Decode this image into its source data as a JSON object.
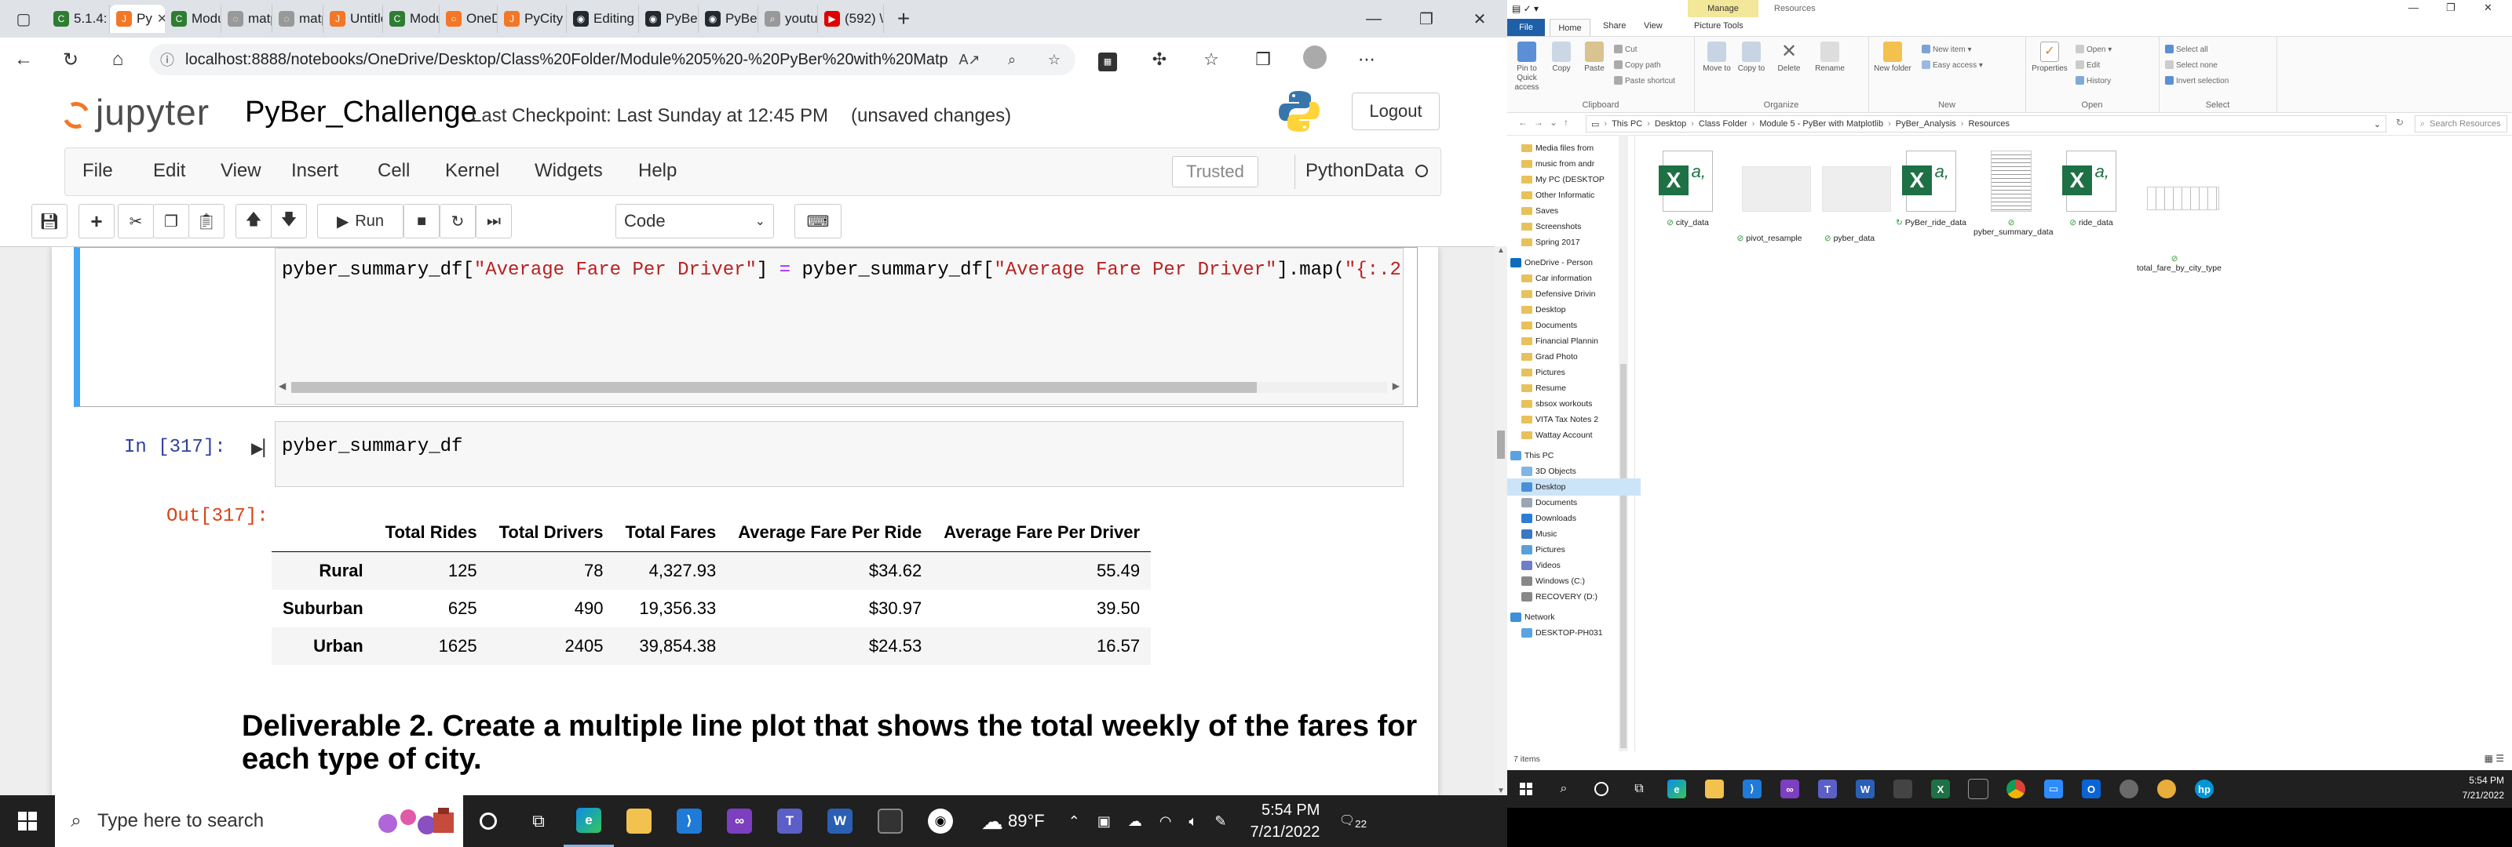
{
  "browser": {
    "tabs": [
      {
        "label": "5.1.4: A",
        "fav_color": "#2e7d32",
        "fav_glyph": "C"
      },
      {
        "label": "Py",
        "fav_color": "#f37726",
        "fav_glyph": "J",
        "active": true
      },
      {
        "label": "Modul",
        "fav_color": "#2e7d32",
        "fav_glyph": "C"
      },
      {
        "label": "matpl",
        "fav_color": "#999999",
        "fav_glyph": "◌"
      },
      {
        "label": "matpl",
        "fav_color": "#999999",
        "fav_glyph": "◌"
      },
      {
        "label": "Untitle",
        "fav_color": "#f37726",
        "fav_glyph": "J"
      },
      {
        "label": "Modul",
        "fav_color": "#2e7d32",
        "fav_glyph": "C"
      },
      {
        "label": "OneDr",
        "fav_color": "#f37726",
        "fav_glyph": "○"
      },
      {
        "label": "PyCity",
        "fav_color": "#f37726",
        "fav_glyph": "J"
      },
      {
        "label": "Editing",
        "fav_color": "#24292f",
        "fav_glyph": "◉"
      },
      {
        "label": "PyBer_",
        "fav_color": "#24292f",
        "fav_glyph": "◉"
      },
      {
        "label": "PyBer_",
        "fav_color": "#24292f",
        "fav_glyph": "◉"
      },
      {
        "label": "youtul",
        "fav_color": "#999999",
        "fav_glyph": "⌕"
      },
      {
        "label": "(592) \\",
        "fav_color": "#e00000",
        "fav_glyph": "▶"
      }
    ],
    "url": "localhost:8888/notebooks/OneDrive/Desktop/Class%20Folder/Module%205%20-%20PyBer%20with%20Matpl..."
  },
  "jupyter": {
    "logo_text": "jupyter",
    "notebook_name": "PyBer_Challenge",
    "checkpoint": "Last Checkpoint: Last Sunday at 12:45 PM",
    "unsaved": "(unsaved changes)",
    "logout": "Logout",
    "menu": [
      "File",
      "Edit",
      "View",
      "Insert",
      "Cell",
      "Kernel",
      "Widgets",
      "Help"
    ],
    "trusted": "Trusted",
    "kernel": "PythonData",
    "run_label": "Run",
    "cell_type": "Code"
  },
  "cells": {
    "code1_a": "pyber_summary_df[",
    "code1_s1": "\"Average Fare Per Driver\"",
    "code1_b": "] ",
    "code1_eq": "=",
    "code1_c": " pyber_summary_df[",
    "code1_s2": "\"Average Fare Per Driver\"",
    "code1_d": "].map(",
    "code1_s3": "\"{:.2",
    "in_prompt": "In [317]:",
    "code2": "pyber_summary_df",
    "out_prompt": "Out[317]:"
  },
  "table": {
    "columns": [
      "",
      "Total Rides",
      "Total Drivers",
      "Total Fares",
      "Average Fare Per Ride",
      "Average Fare Per Driver"
    ],
    "rows": [
      [
        "Rural",
        "125",
        "78",
        "4,327.93",
        "$34.62",
        "55.49"
      ],
      [
        "Suburban",
        "625",
        "490",
        "19,356.33",
        "$30.97",
        "39.50"
      ],
      [
        "Urban",
        "1625",
        "2405",
        "39,854.38",
        "$24.53",
        "16.57"
      ]
    ]
  },
  "heading": "Deliverable 2. Create a multiple line plot that shows the total weekly of the fares for each type of city.",
  "taskbar": {
    "search_placeholder": "Type here to search",
    "temperature": "89°F",
    "time": "5:54 PM",
    "date": "7/21/2022",
    "notifications": "22"
  },
  "explorer": {
    "manage": "Manage",
    "title": "Resources",
    "tabs": [
      "File",
      "Home",
      "Share",
      "View",
      "Picture Tools"
    ],
    "ribbon": {
      "pin": "Pin to Quick access",
      "copy": "Copy",
      "paste": "Paste",
      "cut": "Cut",
      "copy_path": "Copy path",
      "paste_shortcut": "Paste shortcut",
      "move_to": "Move to",
      "copy_to": "Copy to",
      "delete": "Delete",
      "rename": "Rename",
      "new_folder": "New folder",
      "new_item": "New item",
      "easy_access": "Easy access",
      "properties": "Properties",
      "open": "Open",
      "edit": "Edit",
      "history": "History",
      "select_all": "Select all",
      "select_none": "Select none",
      "invert_selection": "Invert selection",
      "groups": [
        "Clipboard",
        "Organize",
        "New",
        "Open",
        "Select"
      ]
    },
    "path": [
      "This PC",
      "Desktop",
      "Class Folder",
      "Module 5 - PyBer with Matplotlib",
      "PyBer_Analysis",
      "Resources"
    ],
    "search_placeholder": "Search Resources",
    "nav": [
      "Media files from",
      "music from andr",
      "My PC (DESKTOP",
      "Other Informatic",
      "Saves",
      "Screenshots",
      "Spring 2017",
      "OneDrive - Person",
      "Car information",
      "Defensive Drivin",
      "Desktop",
      "Documents",
      "Financial Plannin",
      "Grad Photo",
      "Pictures",
      "Resume",
      "sbsox workouts",
      "VITA Tax Notes 2",
      "Wattay Account",
      "This PC",
      "3D Objects",
      "Desktop",
      "Documents",
      "Downloads",
      "Music",
      "Pictures",
      "Videos",
      "Windows (C:)",
      "RECOVERY (D:)",
      "Network",
      "DESKTOP-PH031"
    ],
    "files": [
      {
        "name": "city_data",
        "kind": "excel"
      },
      {
        "name": "pivot_resample",
        "kind": "blank"
      },
      {
        "name": "pyber_data",
        "kind": "blank"
      },
      {
        "name": "PyBer_ride_data",
        "kind": "excel"
      },
      {
        "name": "pyber_summary_data",
        "kind": "doc"
      },
      {
        "name": "ride_data",
        "kind": "excel"
      },
      {
        "name": "total_fare_by_city_type",
        "kind": "table"
      }
    ],
    "status": "7 items",
    "time": "5:54 PM",
    "date": "7/21/2022"
  }
}
